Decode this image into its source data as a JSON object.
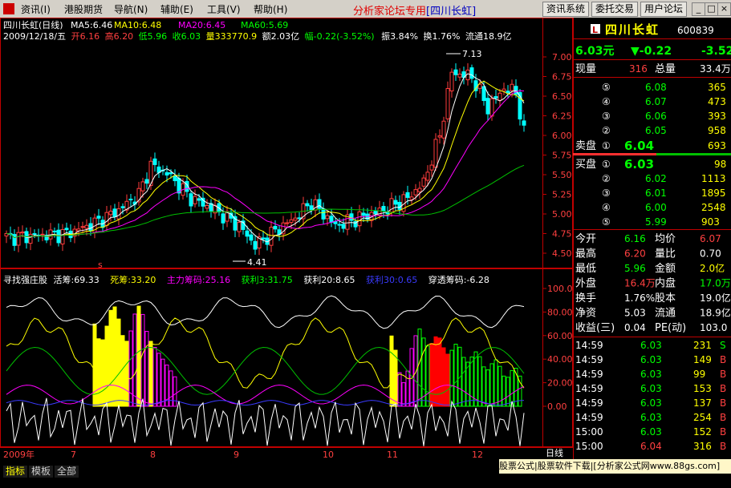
{
  "menu": {
    "items": [
      "资讯(I)",
      "港股期货",
      "导航(N)",
      "辅助(E)",
      "工具(V)",
      "帮助(H)"
    ],
    "title_main": "分析家论坛专用",
    "title_stock": "[四川长虹]",
    "buttons": [
      "资讯系统",
      "委托交易",
      "用户论坛"
    ]
  },
  "kline": {
    "name": "四川长虹(日线)",
    "ma": [
      {
        "label": "MA5:6.46",
        "color": "#ffffff"
      },
      {
        "label": "MA10:6.48",
        "color": "#ffff00"
      },
      {
        "label": "MA20:6.45",
        "color": "#ff00ff"
      },
      {
        "label": "MA60:5.69",
        "color": "#00ff00"
      }
    ],
    "info": {
      "date": "2009/12/18/五",
      "open": "开6.16",
      "high": "高6.20",
      "low": "低5.96",
      "close": "收6.03",
      "volume": "量333770.9",
      "amount": "额2.03亿",
      "change": "幅-0.22(-3.52%)",
      "amplitude": "振3.84%",
      "turnover": "换1.76%",
      "float": "流通18.9亿"
    },
    "price_axis": [
      "7.00",
      "6.75",
      "6.50",
      "6.25",
      "6.00",
      "5.75",
      "5.50",
      "5.25",
      "5.00",
      "4.75",
      "4.50"
    ],
    "high_mark": "7.13",
    "low_mark": "4.41"
  },
  "indicator": {
    "name": "寻找强庄股",
    "items": [
      {
        "label": "活筹:69.33",
        "color": "#ffffff"
      },
      {
        "label": "死筹:33.20",
        "color": "#ffff00"
      },
      {
        "label": "主力筹码:25.16",
        "color": "#ff00ff"
      },
      {
        "label": "获利3:31.75",
        "color": "#00ff00"
      },
      {
        "label": "获利20:8.65",
        "color": "#ffffff"
      },
      {
        "label": "获利30:0.65",
        "color": "#0000ff"
      },
      {
        "label": "穿透筹码:-6.28",
        "color": "#ffffff"
      }
    ],
    "axis": [
      "100.00",
      "80.00",
      "60.00",
      "40.00",
      "20.00",
      "0.00"
    ],
    "marker": "s"
  },
  "date_axis": [
    "2009年",
    "7",
    "8",
    "9",
    "10",
    "11",
    "12"
  ],
  "period_label": "日线",
  "tabs": [
    "指标",
    "模板",
    "全部"
  ],
  "ad_text": "股票公式|股票软件下载|[分析家公式网www.88gs.com]",
  "quote": {
    "logo": "L",
    "name": "四川长虹",
    "code": "600839",
    "price": "6.03元",
    "change": "▼-0.22",
    "change_pct": "-3.52",
    "now_vol_label": "现量",
    "now_vol": "316",
    "total_vol_label": "总量",
    "total_vol": "33.4万",
    "sell": [
      {
        "level": "⑤",
        "price": "6.08",
        "vol": "365"
      },
      {
        "level": "④",
        "price": "6.07",
        "vol": "473"
      },
      {
        "level": "③",
        "price": "6.06",
        "vol": "393"
      },
      {
        "level": "②",
        "price": "6.05",
        "vol": "958"
      }
    ],
    "sell1_label": "卖盘",
    "sell1": {
      "level": "①",
      "price": "6.04",
      "vol": "693"
    },
    "buy1_label": "买盘",
    "buy1": {
      "level": "①",
      "price": "6.03",
      "vol": "98"
    },
    "buy": [
      {
        "level": "②",
        "price": "6.02",
        "vol": "1113"
      },
      {
        "level": "③",
        "price": "6.01",
        "vol": "1895"
      },
      {
        "level": "④",
        "price": "6.00",
        "vol": "2548"
      },
      {
        "level": "⑤",
        "price": "5.99",
        "vol": "903"
      }
    ],
    "stats": [
      [
        "今开",
        "6.16",
        "均价",
        "6.07"
      ],
      [
        "最高",
        "6.20",
        "量比",
        "0.70"
      ],
      [
        "最低",
        "5.96",
        "金额",
        "2.0亿"
      ],
      [
        "外盘",
        "16.4万",
        "内盘",
        "17.0万"
      ],
      [
        "换手",
        "1.76%",
        "股本",
        "19.0亿"
      ],
      [
        "净资",
        "5.03",
        "流通",
        "18.9亿"
      ],
      [
        "收益(三)",
        "0.04",
        "PE(动)",
        "103.0"
      ]
    ],
    "ticks": [
      {
        "time": "14:59",
        "price": "6.03",
        "vol": "231",
        "side": "S"
      },
      {
        "time": "14:59",
        "price": "6.03",
        "vol": "149",
        "side": "B"
      },
      {
        "time": "14:59",
        "price": "6.03",
        "vol": "99",
        "side": "B"
      },
      {
        "time": "14:59",
        "price": "6.03",
        "vol": "153",
        "side": "B"
      },
      {
        "time": "14:59",
        "price": "6.03",
        "vol": "137",
        "side": "B"
      },
      {
        "time": "14:59",
        "price": "6.03",
        "vol": "254",
        "side": "B"
      },
      {
        "time": "15:00",
        "price": "6.03",
        "vol": "152",
        "side": "B"
      },
      {
        "time": "15:00",
        "price": "6.04",
        "vol": "316",
        "side": "B"
      }
    ]
  },
  "colors": {
    "up": "#ff3c3c",
    "down": "#00ffff",
    "bg": "#000000",
    "frame": "#c00000"
  }
}
